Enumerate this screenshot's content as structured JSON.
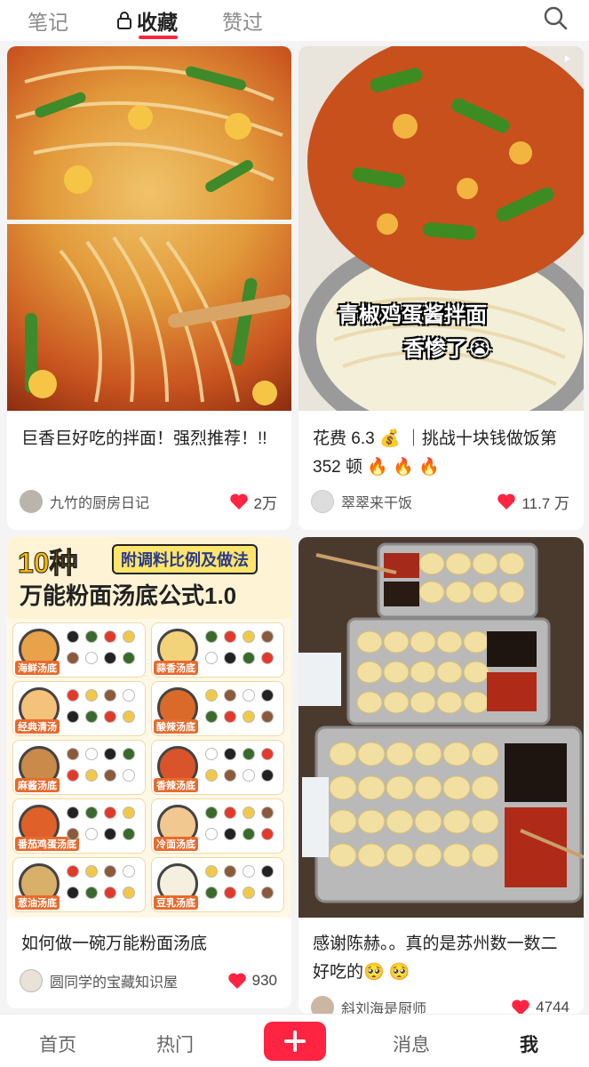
{
  "top_tabs": {
    "notes": "笔记",
    "favorites": "收藏",
    "liked": "赞过"
  },
  "cards": [
    {
      "title": "巨香巨好吃的拌面！强烈推荐！!!",
      "author": "九竹的厨房日记",
      "likes": "2万"
    },
    {
      "title": "花费 6.3 💰 ｜挑战十块钱做饭第 352 顿 🔥 🔥 🔥",
      "author": "翠翠来干饭",
      "likes": "11.7 万",
      "overlay_line1": "青椒鸡蛋酱拌面",
      "overlay_line2": "香惨了😭"
    },
    {
      "title": "如何做一碗万能粉面汤底",
      "author": "圆同学的宝藏知识屋",
      "likes": "930",
      "info_big": "10种",
      "info_tag": "附调料比例及做法",
      "info_sub": "万能粉面汤底公式1.0",
      "info_labels": [
        "海鲜汤底",
        "蒜香汤底",
        "经典清汤",
        "酸辣汤底",
        "麻酱汤底",
        "香辣汤底",
        "番茄鸡蛋汤底",
        "冷面汤底",
        "葱油汤底",
        "豆乳汤底"
      ]
    },
    {
      "title": "感谢陈赫。。真的是苏州数一数二好吃的🥺 🥺",
      "author": "斜刘海是厨师",
      "likes": "4744"
    }
  ],
  "bottom_nav": {
    "home": "首页",
    "hot": "热门",
    "messages": "消息",
    "me": "我"
  },
  "colors": {
    "accent": "#ff2442"
  }
}
